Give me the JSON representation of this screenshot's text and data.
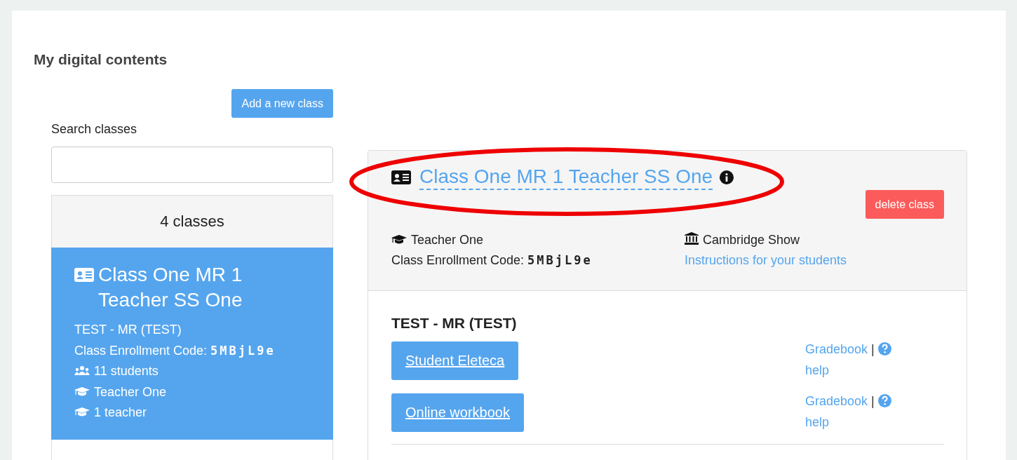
{
  "page_title": "My digital contents",
  "add_class_button": "Add a new class",
  "search": {
    "label": "Search classes"
  },
  "class_count": "4 classes",
  "class_list": [
    {
      "name": "Class One MR 1 Teacher SS One",
      "course": "TEST - MR (TEST)",
      "code_label": "Class Enrollment Code:",
      "code": "5MBjL9e",
      "students": "11 students",
      "teacher": "Teacher One",
      "teachers": "1 teacher",
      "selected": true
    }
  ],
  "detail": {
    "title": "Class One MR 1 Teacher SS One",
    "delete_button": "delete class",
    "teacher": "Teacher One",
    "code_label": "Class Enrollment Code:",
    "code": "5MBjL9e",
    "institution": "Cambridge Show",
    "instructions_link": "Instructions for your students",
    "course": "TEST - MR (TEST)",
    "resources": [
      {
        "label": "Student Eleteca",
        "gradebook": "Gradebook",
        "separator": "|",
        "help": "help"
      },
      {
        "label": "Online workbook",
        "gradebook": "Gradebook",
        "separator": "|",
        "help": "help"
      }
    ]
  },
  "annotation": {
    "kind": "ellipse",
    "color": "#ee0000"
  }
}
